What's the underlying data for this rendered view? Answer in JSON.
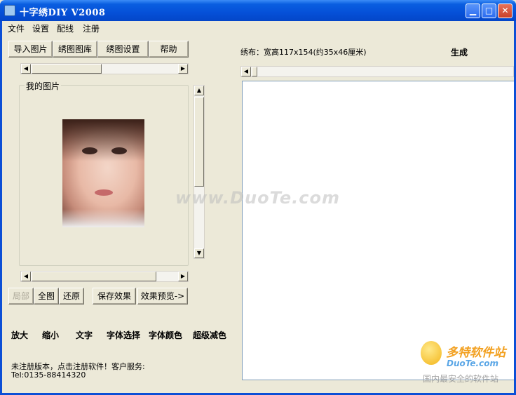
{
  "window": {
    "title": "十字绣DIY  V2008",
    "min_icon": "minimize-icon",
    "max_icon": "maximize-icon",
    "close_icon": "close-icon"
  },
  "menu": [
    "文件",
    "设置",
    "配线",
    "注册"
  ],
  "toolbar": {
    "import": "导入图片",
    "library": "绣图图库",
    "settings": "绣图设置",
    "help": "帮助"
  },
  "group_box": {
    "label": "我的图片"
  },
  "view_buttons": {
    "partial": "局部",
    "full": "全图",
    "restore": "还原",
    "save_effect": "保存效果",
    "preview": "效果预览->"
  },
  "tools": [
    "放大",
    "缩小",
    "文字",
    "字体选择",
    "字体颜色",
    "超级减色"
  ],
  "status": {
    "line1": "未注册版本，点击注册软件！客户服务:",
    "line2": "Tel:0135-88414320"
  },
  "canvas_info": {
    "label": "绣布：宽高117x154(约35x46厘米)",
    "generate": "生成"
  },
  "watermark": {
    "center": "www.DuoTe.com",
    "logo_cn": "多特软件站",
    "logo_en": "DuoTe.com",
    "tagline": "国内最安全的软件站"
  }
}
